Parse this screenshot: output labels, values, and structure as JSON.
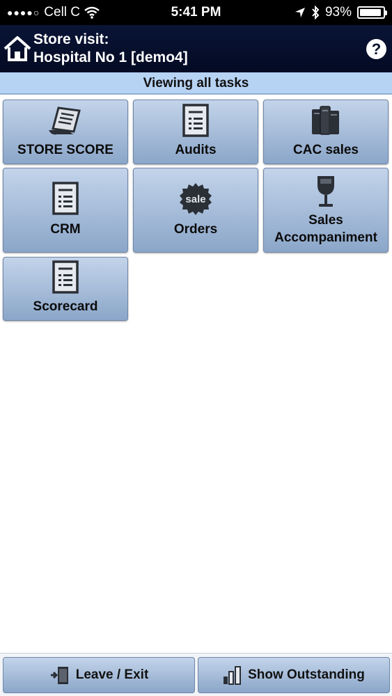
{
  "status_bar": {
    "carrier": "Cell C",
    "time": "5:41 PM",
    "battery_percent": "93%",
    "battery_level": 0.93
  },
  "header": {
    "line1": "Store visit:",
    "line2": "Hospital No 1 [demo4]",
    "help_glyph": "?"
  },
  "subheader": {
    "text": "Viewing all tasks"
  },
  "tasks": [
    {
      "label": "STORE SCORE",
      "icon": "scroll-icon"
    },
    {
      "label": "Audits",
      "icon": "document-icon"
    },
    {
      "label": "CAC sales",
      "icon": "books-icon"
    },
    {
      "label": "CRM",
      "icon": "document-icon"
    },
    {
      "label": "Orders",
      "icon": "sale-badge-icon",
      "badge_text": "sale"
    },
    {
      "label": "Sales Accompaniment",
      "icon": "wine-glass-icon"
    },
    {
      "label": "Scorecard",
      "icon": "document-icon"
    }
  ],
  "footer": {
    "leave_label": "Leave / Exit",
    "outstanding_label": "Show Outstanding"
  },
  "colors": {
    "header_bg": "#030a22",
    "subheader_bg": "#b7d3f4",
    "tile_top": "#c3d4ea",
    "tile_bottom": "#8ba6c9",
    "icon_dark": "#2b2f36"
  }
}
